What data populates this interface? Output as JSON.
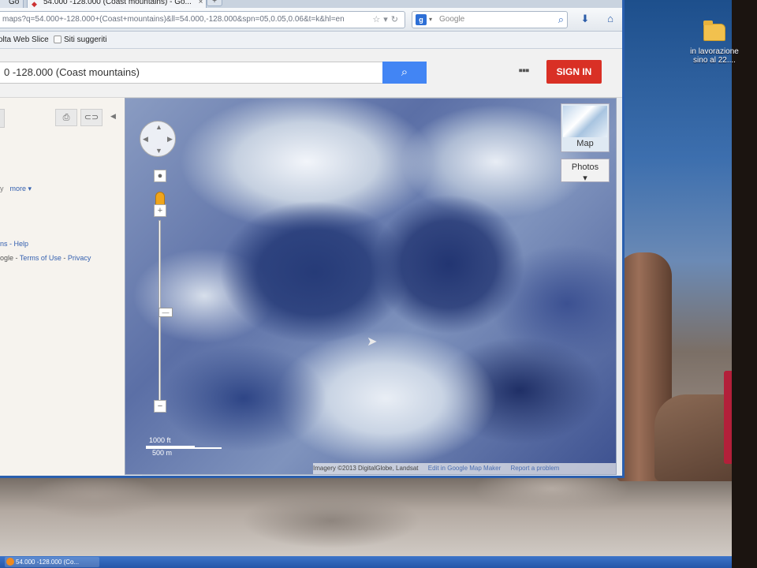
{
  "browser": {
    "tabs": [
      {
        "label": "Go",
        "active": false
      },
      {
        "label": "54.000 -128.000 (Coast mountains) - Go...",
        "active": true
      }
    ],
    "new_tab": "+",
    "url": "maps?q=54.000+-128.000+(Coast+mountains)&ll=54.000,-128.000&spn=05,0.05,0.06&t=k&hl=en",
    "search_engine_letter": "g",
    "search_placeholder": "Google",
    "bookmarks": [
      {
        "label": "olta Web Slice"
      },
      {
        "label": "Siti suggeriti"
      }
    ]
  },
  "maps": {
    "search_value": "0 -128.000 (Coast mountains)",
    "search_button_icon": "search-icon",
    "apps_icon": "apps-grid-icon",
    "sign_in_label": "SIGN IN",
    "left_panel": {
      "print_icon": "print-icon",
      "link_icon": "link-icon",
      "more_label": "more ▾",
      "sep": "y",
      "help_text": "ns - Help",
      "legal_prefix": "ogle -",
      "terms_label": "Terms of Use",
      "legal_sep": "-",
      "privacy_label": "Privacy"
    },
    "map_type": {
      "map_label": "Map",
      "photos_label": "Photos"
    },
    "scale": {
      "ft": "1000 ft",
      "m": "500 m"
    },
    "attribution": {
      "copyright": "Imagery ©2013 DigitalGlobe, Landsat",
      "edit_link": "Edit in Google Map Maker",
      "report_link": "Report a problem"
    }
  },
  "desktop": {
    "folder_label": "in lavorazione sino al 22....",
    "taskbar_item": "54.000 -128.000 (Co..."
  },
  "colors": {
    "accent": "#4285f4",
    "sign_in": "#d93025",
    "taskbar": "#2556a8"
  }
}
